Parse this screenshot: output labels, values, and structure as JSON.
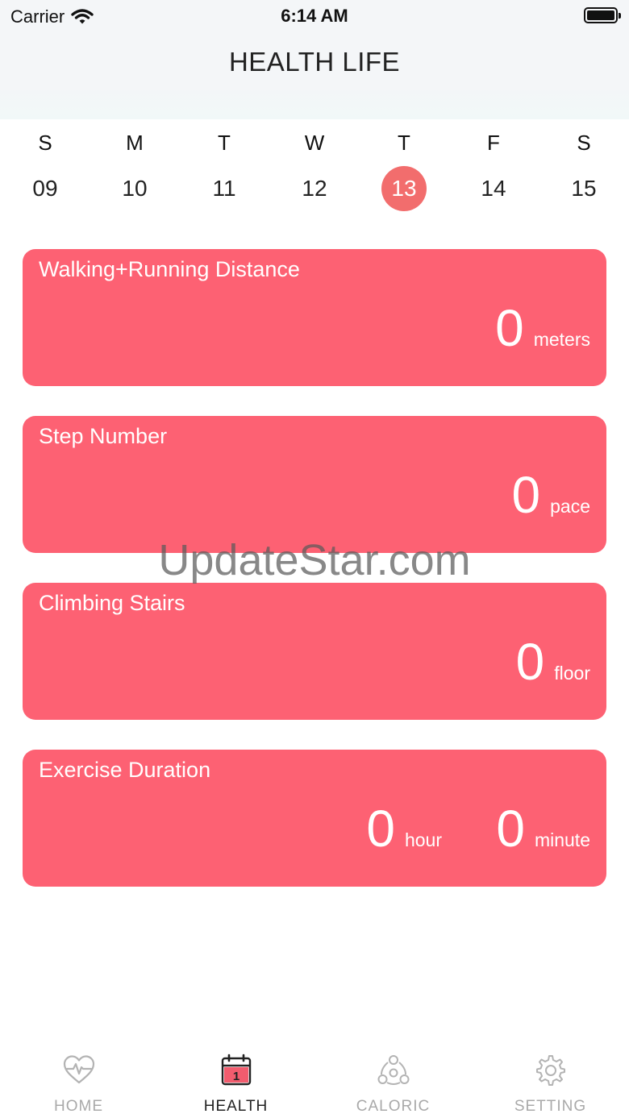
{
  "status_bar": {
    "carrier": "Carrier",
    "time": "6:14 AM"
  },
  "header": {
    "title": "HEALTH LIFE"
  },
  "week": [
    {
      "letter": "S",
      "date": "09",
      "selected": false
    },
    {
      "letter": "M",
      "date": "10",
      "selected": false
    },
    {
      "letter": "T",
      "date": "11",
      "selected": false
    },
    {
      "letter": "W",
      "date": "12",
      "selected": false
    },
    {
      "letter": "T",
      "date": "13",
      "selected": true
    },
    {
      "letter": "F",
      "date": "14",
      "selected": false
    },
    {
      "letter": "S",
      "date": "15",
      "selected": false
    }
  ],
  "cards": {
    "distance": {
      "title": "Walking+Running Distance",
      "value": "0",
      "unit": "meters"
    },
    "steps": {
      "title": "Step Number",
      "value": "0",
      "unit": "pace"
    },
    "stairs": {
      "title": "Climbing Stairs",
      "value": "0",
      "unit": "floor"
    },
    "duration": {
      "title": "Exercise Duration",
      "hours": "0",
      "hour_unit": "hour",
      "minutes": "0",
      "minute_unit": "minute"
    }
  },
  "watermark": "UpdateStar.com",
  "tabs": [
    {
      "label": "HOME",
      "icon": "heart-pulse-icon",
      "active": false
    },
    {
      "label": "HEALTH",
      "icon": "calendar-icon",
      "active": true
    },
    {
      "label": "CALORIC",
      "icon": "molecule-icon",
      "active": false
    },
    {
      "label": "SETTING",
      "icon": "gear-icon",
      "active": false
    }
  ],
  "colors": {
    "card": "#fd6173",
    "selected_date": "#f26d6d",
    "inactive_tab": "#a9a9a9"
  }
}
